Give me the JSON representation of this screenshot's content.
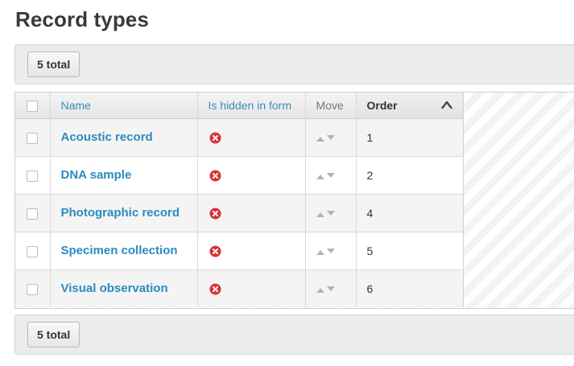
{
  "page": {
    "title": "Record types"
  },
  "pagination": {
    "top_count": "5 total",
    "bottom_count": "5 total"
  },
  "table": {
    "columns": {
      "name": "Name",
      "hidden": "Is hidden in form",
      "move": "Move",
      "order": "Order"
    },
    "sort": {
      "column": "Order",
      "direction": "ascending",
      "icon": "chevron-up-icon"
    },
    "rows": [
      {
        "name": "Acoustic record",
        "hidden_icon": "red-x-circle-icon",
        "order": "1"
      },
      {
        "name": "DNA sample",
        "hidden_icon": "red-x-circle-icon",
        "order": "2"
      },
      {
        "name": "Photographic record",
        "hidden_icon": "red-x-circle-icon",
        "order": "4"
      },
      {
        "name": "Specimen collection",
        "hidden_icon": "red-x-circle-icon",
        "order": "5"
      },
      {
        "name": "Visual observation",
        "hidden_icon": "red-x-circle-icon",
        "order": "6"
      }
    ]
  },
  "colors": {
    "link": "#2b8cc0",
    "header_link": "#3a8fb7",
    "status_no": "#d9343a",
    "title": "#3a3a3a"
  }
}
